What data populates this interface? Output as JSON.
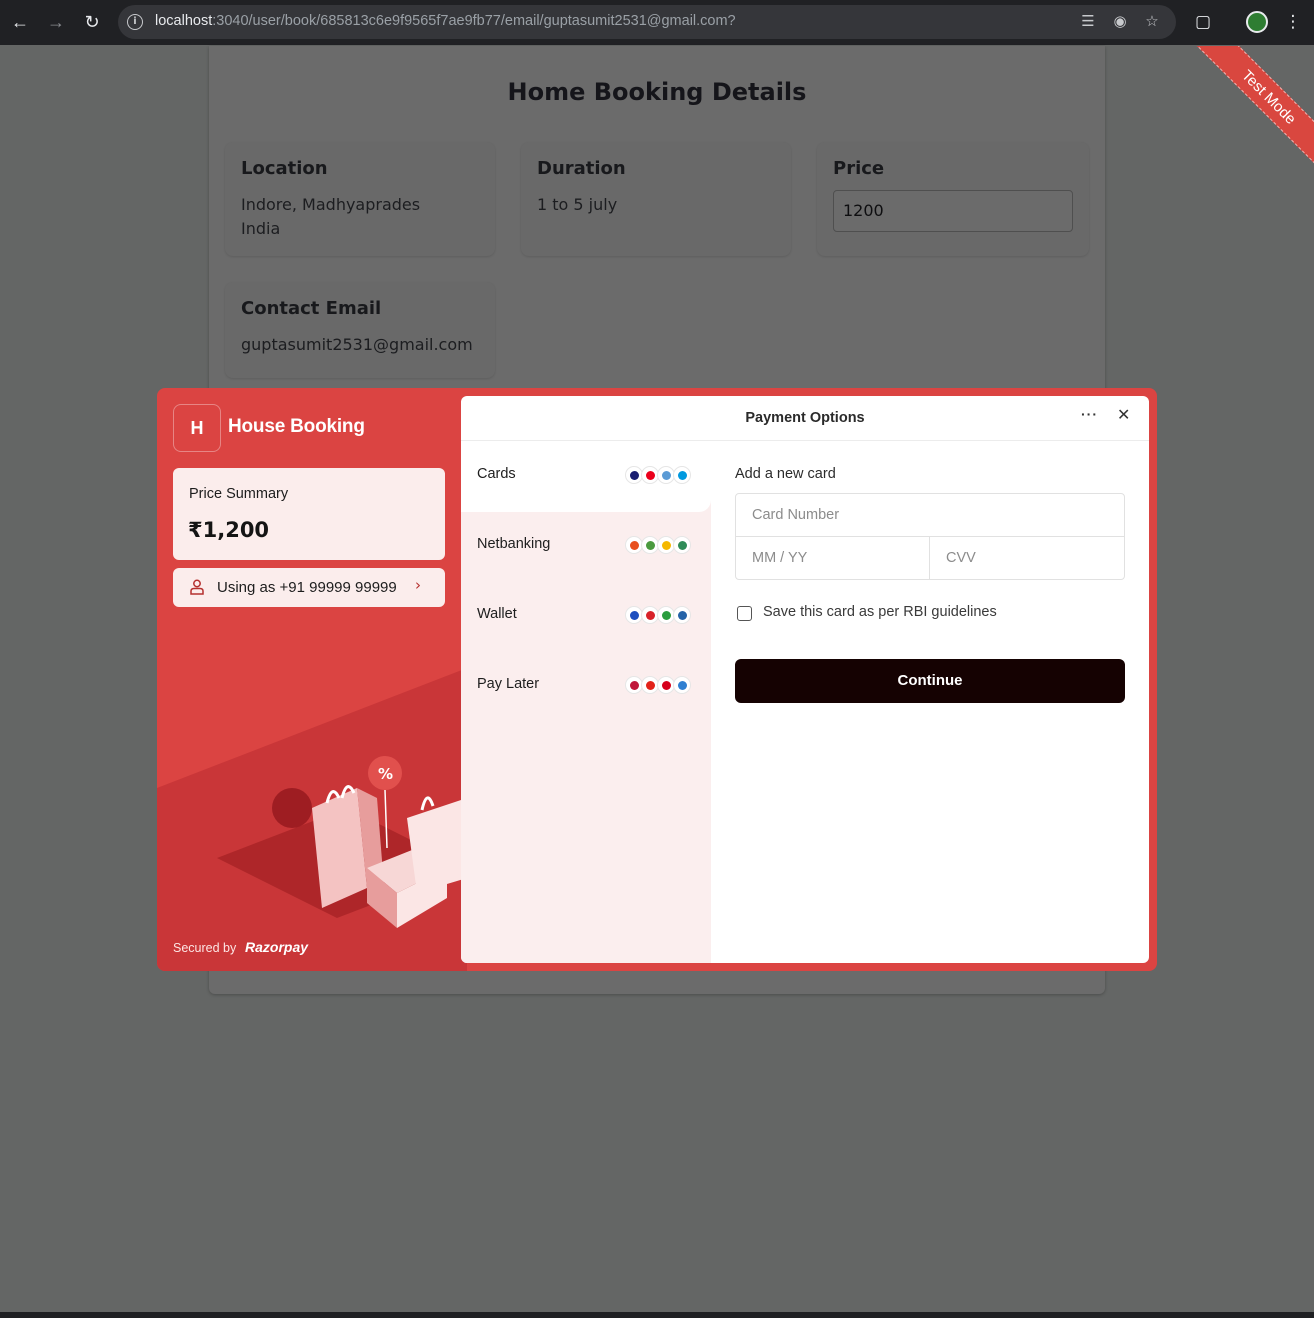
{
  "browser": {
    "url_host": "localhost",
    "url_path": ":3040/user/book/685813c6e9f9565f7ae9fb77/email/guptasumit2531@gmail.com?"
  },
  "page": {
    "title": "Home Booking Details",
    "location": {
      "label": "Location",
      "line1": "Indore, Madhyaprades",
      "line2": "India"
    },
    "duration": {
      "label": "Duration",
      "value": "1 to 5 july"
    },
    "price": {
      "label": "Price",
      "value": "1200"
    },
    "contact": {
      "label": "Contact Email",
      "value": "guptasumit2531@gmail.com"
    }
  },
  "ribbon": "Test Mode",
  "checkout": {
    "merchant_initial": "H",
    "merchant_name": "House Booking",
    "summary_label": "Price Summary",
    "amount": "₹1,200",
    "contact_text": "Using as +91 99999 99999",
    "secured_text": "Secured by",
    "brand": "Razorpay",
    "panel_title": "Payment Options",
    "methods": [
      {
        "label": "Cards",
        "icons": [
          "visa-icon",
          "mastercard-icon",
          "rupay-icon",
          "maestro-icon"
        ],
        "colors": [
          "#1a1f71",
          "#eb001b",
          "#5b9bd5",
          "#0099df"
        ]
      },
      {
        "label": "Netbanking",
        "icons": [
          "bank-icon",
          "bank-icon",
          "bank-icon",
          "bank-icon"
        ],
        "colors": [
          "#e8501f",
          "#4a9a3f",
          "#f5b800",
          "#2e8b57"
        ]
      },
      {
        "label": "Wallet",
        "icons": [
          "wallet-icon",
          "wallet-icon",
          "wallet-icon",
          "wallet-icon"
        ],
        "colors": [
          "#1f4fbf",
          "#d8232a",
          "#2a9d3f",
          "#2563a8"
        ]
      },
      {
        "label": "Pay Later",
        "icons": [
          "paylater-icon",
          "paylater-icon",
          "paylater-icon",
          "paylater-icon"
        ],
        "colors": [
          "#c0183b",
          "#e2231a",
          "#d6001c",
          "#2f7fd1"
        ]
      }
    ],
    "form": {
      "heading": "Add a new card",
      "card_number_placeholder": "Card Number",
      "expiry_placeholder": "MM / YY",
      "cvv_placeholder": "CVV",
      "save_label": "Save this card as per RBI guidelines",
      "continue_label": "Continue"
    },
    "accent_color": "#db4442"
  }
}
